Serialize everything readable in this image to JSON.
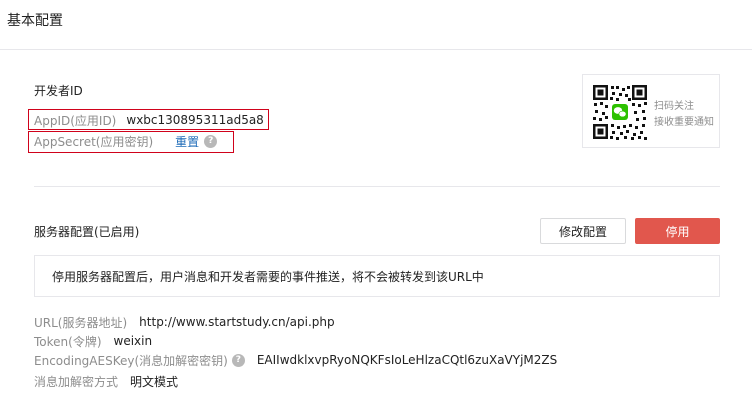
{
  "page": {
    "title": "基本配置"
  },
  "developer": {
    "heading": "开发者ID",
    "appid_label": "AppID(应用ID)",
    "appid_value": "wxbc130895311ad5a8",
    "secret_label": "AppSecret(应用密钥)",
    "reset_label": "重置",
    "help_glyph": "?"
  },
  "qr": {
    "line1": "扫码关注",
    "line2": "接收重要通知"
  },
  "server": {
    "heading": "服务器配置(已启用)",
    "modify_label": "修改配置",
    "stop_label": "停用",
    "notice": "停用服务器配置后，用户消息和开发者需要的事件推送，将不会被转发到该URL中",
    "url_label": "URL(服务器地址)",
    "url_value": "http://www.startstudy.cn/api.php",
    "token_label": "Token(令牌)",
    "token_value": "weixin",
    "aes_label": "EncodingAESKey(消息加解密密钥)",
    "aes_value": "EAIIwdklxvpRyoNQKFsIoLeHlzaCQtl6zuXaVYjM2ZS",
    "mode_label": "消息加解密方式",
    "mode_value": "明文模式"
  },
  "colors": {
    "accent_red": "#e1574d",
    "link_blue": "#1e6bb8",
    "highlight_box": "#d0021b",
    "wechat_green": "#2dc100"
  },
  "icons": [
    "qr-code-icon",
    "wechat-logo-icon",
    "help-icon"
  ]
}
